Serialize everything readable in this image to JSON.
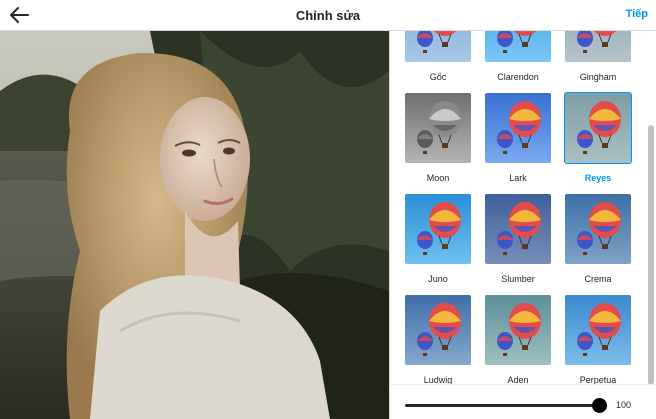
{
  "header": {
    "title": "Chỉnh sửa",
    "next_label": "Tiếp"
  },
  "icons": {
    "back": "back-arrow-icon"
  },
  "accent_color": "#0095f6",
  "filters": [
    {
      "name": "Gốc"
    },
    {
      "name": "Clarendon"
    },
    {
      "name": "Gingham"
    },
    {
      "name": "Moon"
    },
    {
      "name": "Lark"
    },
    {
      "name": "Reyes",
      "selected": true
    },
    {
      "name": "Juno"
    },
    {
      "name": "Slumber"
    },
    {
      "name": "Crema"
    },
    {
      "name": "Ludwig"
    },
    {
      "name": "Aden"
    },
    {
      "name": "Perpetua"
    }
  ],
  "slider": {
    "value": "100",
    "fraction": 1.0
  }
}
